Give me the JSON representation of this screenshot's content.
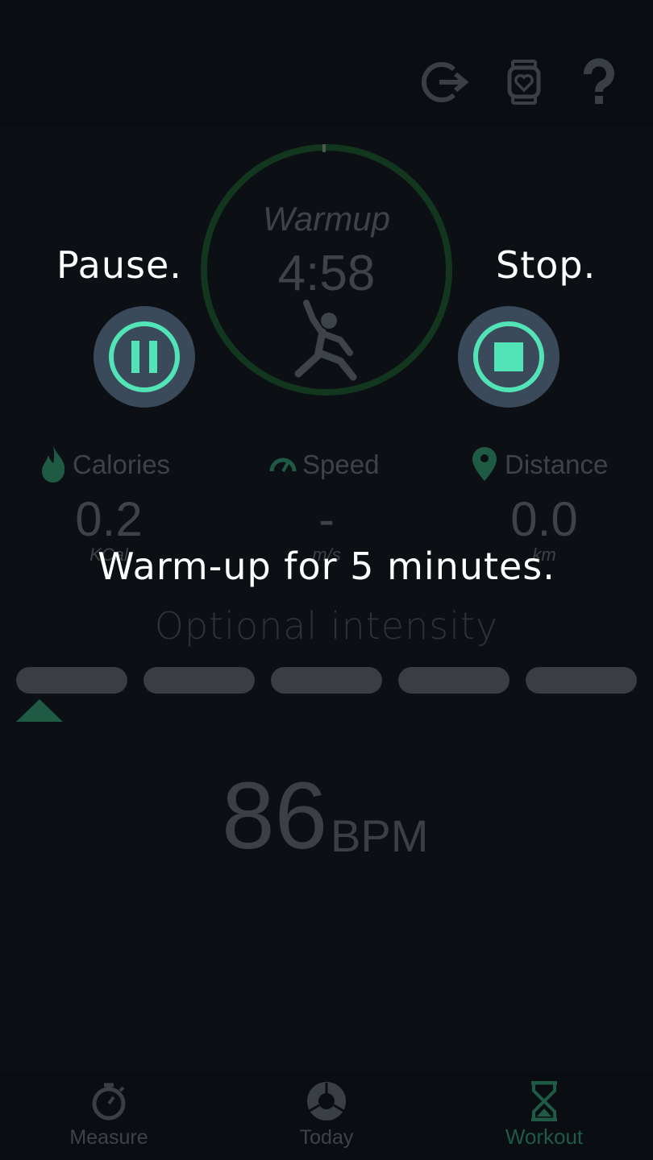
{
  "header": {
    "icons": [
      "exit-icon",
      "watch-heart-icon",
      "help-icon"
    ]
  },
  "workout": {
    "phase": "Warmup",
    "timer": "4:58"
  },
  "overlay": {
    "pause_caption": "Pause.",
    "stop_caption": "Stop.",
    "hint": "Warm-up for 5 minutes."
  },
  "stats": {
    "calories": {
      "label": "Calories",
      "value": "0.2",
      "unit": "KCal"
    },
    "speed": {
      "label": "Speed",
      "value": "-",
      "unit": "m/s"
    },
    "distance": {
      "label": "Distance",
      "value": "0.0",
      "unit": "km"
    }
  },
  "intensity": {
    "label": "Optional intensity",
    "selected_index": 0
  },
  "heart_rate": {
    "value": "86",
    "unit": "BPM"
  },
  "nav": {
    "items": [
      {
        "label": "Measure"
      },
      {
        "label": "Today"
      },
      {
        "label": "Workout"
      }
    ],
    "active_color": "#1f5a45"
  },
  "colors": {
    "accent": "#52e3b6",
    "ring": "#13361f"
  }
}
